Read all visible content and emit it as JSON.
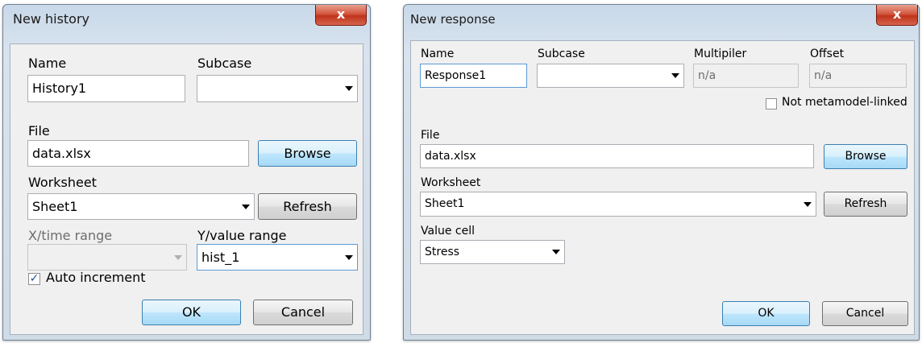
{
  "history_dialog": {
    "title": "New history",
    "close_label": "x",
    "name_label": "Name",
    "name_value": "History1",
    "subcase_label": "Subcase",
    "subcase_value": "",
    "file_label": "File",
    "file_value": "data.xlsx",
    "browse_label": "Browse",
    "worksheet_label": "Worksheet",
    "worksheet_value": "Sheet1",
    "refresh_label": "Refresh",
    "x_range_label": "X/time range",
    "x_range_value": "",
    "y_range_label": "Y/value range",
    "y_range_value": "hist_1",
    "auto_increment_label": "Auto increment",
    "auto_increment_checked": true,
    "ok_label": "OK",
    "cancel_label": "Cancel"
  },
  "response_dialog": {
    "title": "New response",
    "close_label": "x",
    "name_label": "Name",
    "name_value": "Response1",
    "subcase_label": "Subcase",
    "subcase_value": "",
    "multiplier_label": "Multipiler",
    "multiplier_value": "n/a",
    "offset_label": "Offset",
    "offset_value": "n/a",
    "not_linked_label": "Not metamodel-linked",
    "not_linked_checked": false,
    "file_label": "File",
    "file_value": "data.xlsx",
    "browse_label": "Browse",
    "worksheet_label": "Worksheet",
    "worksheet_value": "Sheet1",
    "refresh_label": "Refresh",
    "value_cell_label": "Value cell",
    "value_cell_value": "Stress",
    "ok_label": "OK",
    "cancel_label": "Cancel"
  },
  "colors": {
    "title_bar": "#c9d9e9",
    "close_button": "#c0331b",
    "panel": "#f0f0f0",
    "default_button": "#bee6fd",
    "check_mark": "#1c4fa0"
  },
  "icons": [
    "close-icon",
    "dropdown-caret-icon",
    "checkmark-icon"
  ]
}
